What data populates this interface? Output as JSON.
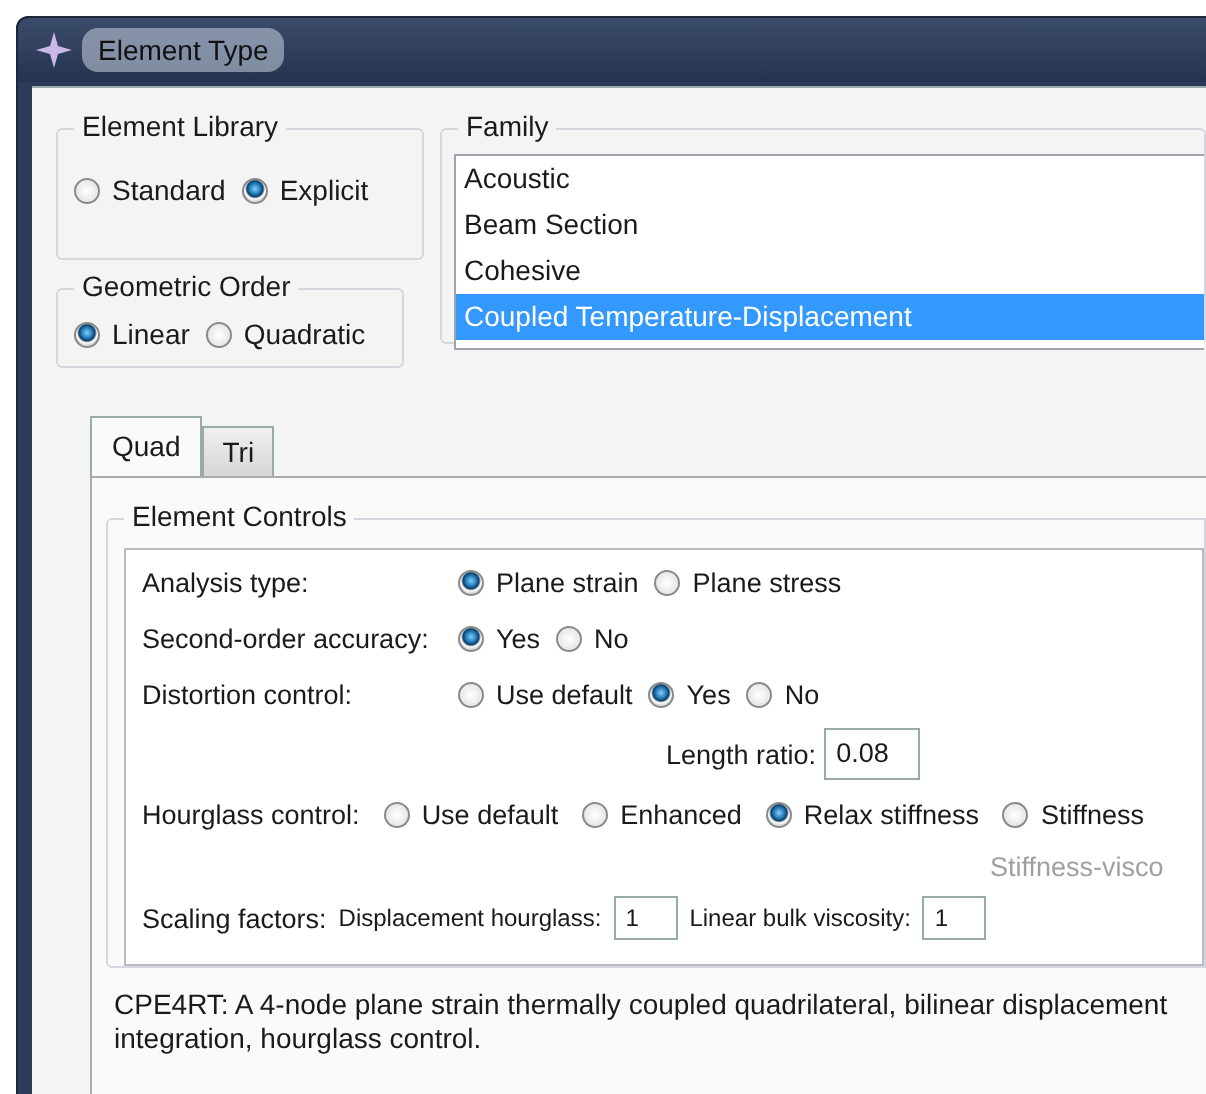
{
  "window": {
    "title": "Element Type"
  },
  "element_library": {
    "title": "Element Library",
    "options": [
      {
        "label": "Standard",
        "selected": false
      },
      {
        "label": "Explicit",
        "selected": true
      }
    ]
  },
  "geometric_order": {
    "title": "Geometric Order",
    "options": [
      {
        "label": "Linear",
        "selected": true
      },
      {
        "label": "Quadratic",
        "selected": false
      }
    ]
  },
  "family": {
    "title": "Family",
    "items": [
      {
        "label": "Acoustic",
        "selected": false
      },
      {
        "label": "Beam Section",
        "selected": false
      },
      {
        "label": "Cohesive",
        "selected": false
      },
      {
        "label": "Coupled Temperature-Displacement",
        "selected": true
      }
    ]
  },
  "tabs": [
    {
      "label": "Quad",
      "selected": true
    },
    {
      "label": "Tri",
      "selected": false
    }
  ],
  "element_controls": {
    "title": "Element Controls",
    "rows": [
      {
        "kind": "radio",
        "label": "Analysis type:",
        "options": [
          {
            "label": "Plane strain",
            "selected": true
          },
          {
            "label": "Plane stress",
            "selected": false
          }
        ]
      },
      {
        "kind": "radio",
        "label": "Second-order accuracy:",
        "options": [
          {
            "label": "Yes",
            "selected": true
          },
          {
            "label": "No",
            "selected": false
          }
        ]
      },
      {
        "kind": "radio",
        "label": "Distortion control:",
        "options": [
          {
            "label": "Use default",
            "selected": false
          },
          {
            "label": "Yes",
            "selected": true
          },
          {
            "label": "No",
            "selected": false
          }
        ]
      },
      {
        "kind": "field",
        "label": "Length ratio:",
        "value": "0.08"
      },
      {
        "kind": "radio-wide",
        "label": "Hourglass control:",
        "options": [
          {
            "label": "Use default",
            "selected": false
          },
          {
            "label": "Enhanced",
            "selected": false
          },
          {
            "label": "Relax stiffness",
            "selected": true
          },
          {
            "label": "Stiffness",
            "selected": false
          }
        ]
      },
      {
        "kind": "note",
        "label": "Stiffness-visco"
      },
      {
        "kind": "scaling",
        "label": "Scaling factors:",
        "fields": [
          {
            "label": "Displacement hourglass:",
            "value": "1"
          },
          {
            "label": "Linear bulk viscosity:",
            "value": "1"
          }
        ]
      }
    ]
  },
  "description": {
    "lines": [
      "CPE4RT:  A 4-node plane strain thermally coupled quadrilateral, bilinear displacement",
      "integration, hourglass control."
    ]
  }
}
